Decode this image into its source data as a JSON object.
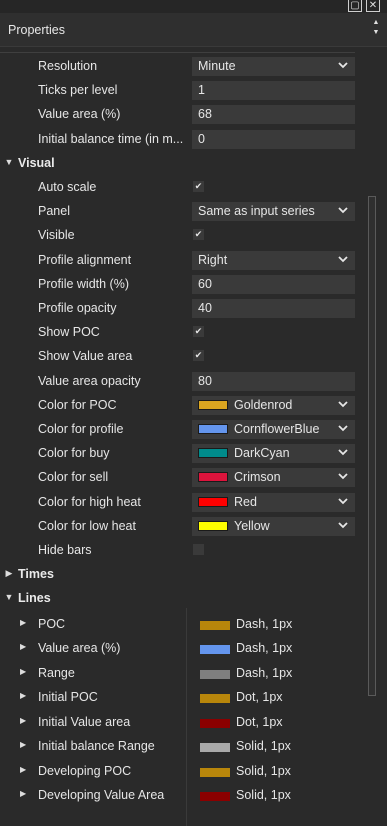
{
  "window": {
    "min_glyph": "▢",
    "close_glyph": "✕"
  },
  "header": {
    "title": "Properties",
    "scroll_up": "▲",
    "scroll_down": "▼"
  },
  "params": [
    {
      "label": "Resolution",
      "type": "select",
      "value": "Minute"
    },
    {
      "label": "Ticks per level",
      "type": "text",
      "value": "1"
    },
    {
      "label": "Value area (%)",
      "type": "text",
      "value": "68"
    },
    {
      "label": "Initial balance time (in m...",
      "type": "text",
      "value": "0"
    }
  ],
  "visual": {
    "category": "Visual",
    "rows": [
      {
        "label": "Auto scale",
        "type": "check",
        "checked": true
      },
      {
        "label": "Panel",
        "type": "select",
        "value": "Same as input series"
      },
      {
        "label": "Visible",
        "type": "check",
        "checked": true
      },
      {
        "label": "Profile alignment",
        "type": "select",
        "value": "Right"
      },
      {
        "label": "Profile width (%)",
        "type": "text",
        "value": "60"
      },
      {
        "label": "Profile opacity",
        "type": "text",
        "value": "40"
      },
      {
        "label": "Show POC",
        "type": "check",
        "checked": true
      },
      {
        "label": "Show Value area",
        "type": "check",
        "checked": true
      },
      {
        "label": "Value area opacity",
        "type": "text",
        "value": "80"
      },
      {
        "label": "Color for POC",
        "type": "color",
        "value": "Goldenrod",
        "color": "#DAA520"
      },
      {
        "label": "Color for profile",
        "type": "color",
        "value": "CornflowerBlue",
        "color": "#6495ED"
      },
      {
        "label": "Color for buy",
        "type": "color",
        "value": "DarkCyan",
        "color": "#008B8B"
      },
      {
        "label": "Color for sell",
        "type": "color",
        "value": "Crimson",
        "color": "#DC143C"
      },
      {
        "label": "Color for high heat",
        "type": "color",
        "value": "Red",
        "color": "#FF0000"
      },
      {
        "label": "Color for low heat",
        "type": "color",
        "value": "Yellow",
        "color": "#FFFF00"
      },
      {
        "label": "Hide bars",
        "type": "check",
        "checked": false
      }
    ]
  },
  "times": {
    "category": "Times"
  },
  "lines": {
    "category": "Lines",
    "rows": [
      {
        "label": "POC",
        "value": "Dash, 1px",
        "color": "#B8860B"
      },
      {
        "label": "Value area (%)",
        "value": "Dash, 1px",
        "color": "#6495ED"
      },
      {
        "label": "Range",
        "value": "Dash, 1px",
        "color": "#7F7F7F"
      },
      {
        "label": "Initial POC",
        "value": "Dot, 1px",
        "color": "#B8860B"
      },
      {
        "label": "Initial Value area",
        "value": "Dot, 1px",
        "color": "#8B0000"
      },
      {
        "label": "Initial balance Range",
        "value": "Solid, 1px",
        "color": "#A9A9A9"
      },
      {
        "label": "Developing POC",
        "value": "Solid, 1px",
        "color": "#B8860B"
      },
      {
        "label": "Developing Value Area",
        "value": "Solid, 1px",
        "color": "#8B0000"
      }
    ]
  },
  "glyphs": {
    "expanded": "▼",
    "collapsed": "▶",
    "check": "✔"
  }
}
